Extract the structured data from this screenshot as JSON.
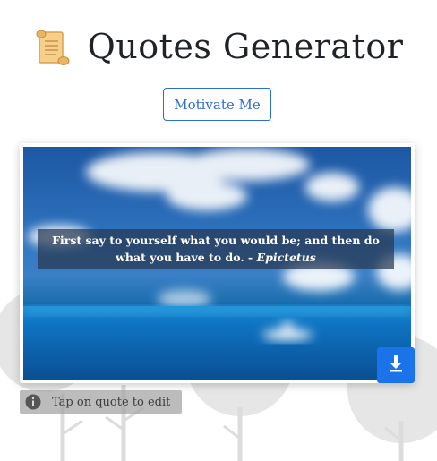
{
  "header": {
    "icon": "scroll-icon",
    "title": "Quotes Generator"
  },
  "actions": {
    "motivate_label": "Motivate Me"
  },
  "quote": {
    "text": "First say to yourself what you would be; and then do what you have to do. - ",
    "author": "Epictetus"
  },
  "download": {
    "icon": "download-icon",
    "color": "#1a73e8"
  },
  "hint": {
    "icon": "info-icon",
    "text": "Tap on quote to edit"
  },
  "colors": {
    "accent": "#2d6bd6",
    "download": "#1a73e8"
  }
}
